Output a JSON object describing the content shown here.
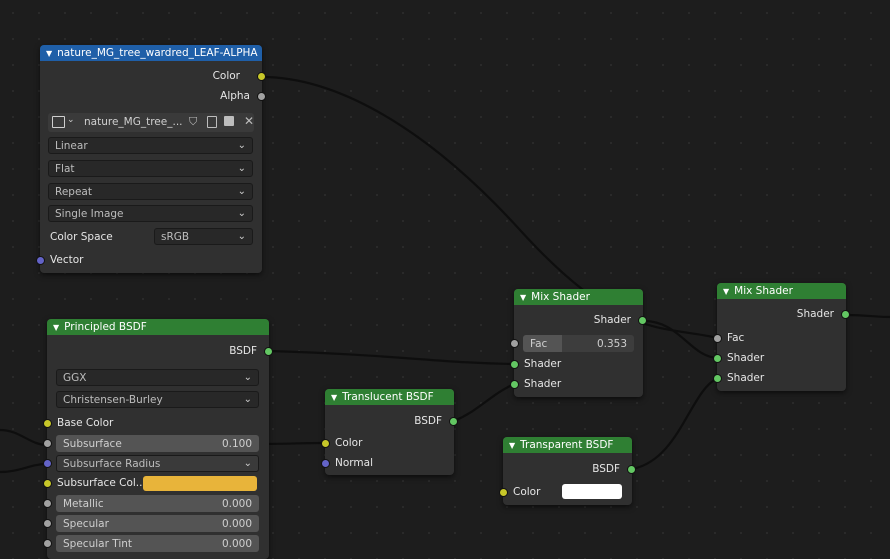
{
  "nodes": {
    "image_texture": {
      "title": "nature_MG_tree_wardred_LEAF-ALPHA",
      "outputs": [
        "Color",
        "Alpha"
      ],
      "image_name": "nature_MG_tree_...",
      "interpolation": "Linear",
      "projection": "Flat",
      "extension": "Repeat",
      "source": "Single Image",
      "color_space_label": "Color Space",
      "color_space": "sRGB",
      "input_vector": "Vector",
      "icons": [
        "image-icon",
        "shield-icon",
        "copy-icon",
        "stack-icon",
        "close-icon"
      ]
    },
    "principled": {
      "title": "Principled BSDF",
      "output": "BSDF",
      "distribution": "GGX",
      "subsurface_method": "Christensen-Burley",
      "base_color_label": "Base Color",
      "subsurface_label": "Subsurface",
      "subsurface_value": "0.100",
      "subsurface_radius_label": "Subsurface Radius",
      "subsurface_color_label": "Subsurface Col...",
      "subsurface_color": "#e8b43a",
      "metallic_label": "Metallic",
      "metallic_value": "0.000",
      "specular_label": "Specular",
      "specular_value": "0.000",
      "specular_tint_label": "Specular Tint",
      "specular_tint_value": "0.000"
    },
    "translucent": {
      "title": "Translucent BSDF",
      "output": "BSDF",
      "input_color": "Color",
      "input_normal": "Normal"
    },
    "mix1": {
      "title": "Mix Shader",
      "output": "Shader",
      "fac_label": "Fac",
      "fac_value": "0.353",
      "input_shader1": "Shader",
      "input_shader2": "Shader"
    },
    "transparent": {
      "title": "Transparent BSDF",
      "output": "BSDF",
      "input_color": "Color",
      "color_swatch": "#ffffff"
    },
    "mix2": {
      "title": "Mix Shader",
      "output": "Shader",
      "input_fac": "Fac",
      "input_shader1": "Shader",
      "input_shader2": "Shader"
    }
  },
  "colors": {
    "header_texture": "#1f5fa8",
    "header_shader": "#2f7f33",
    "socket_color": "#c7c729",
    "socket_float": "#a1a1a1",
    "socket_shader": "#63c763",
    "socket_vector": "#6363c7",
    "link": "#111111"
  }
}
